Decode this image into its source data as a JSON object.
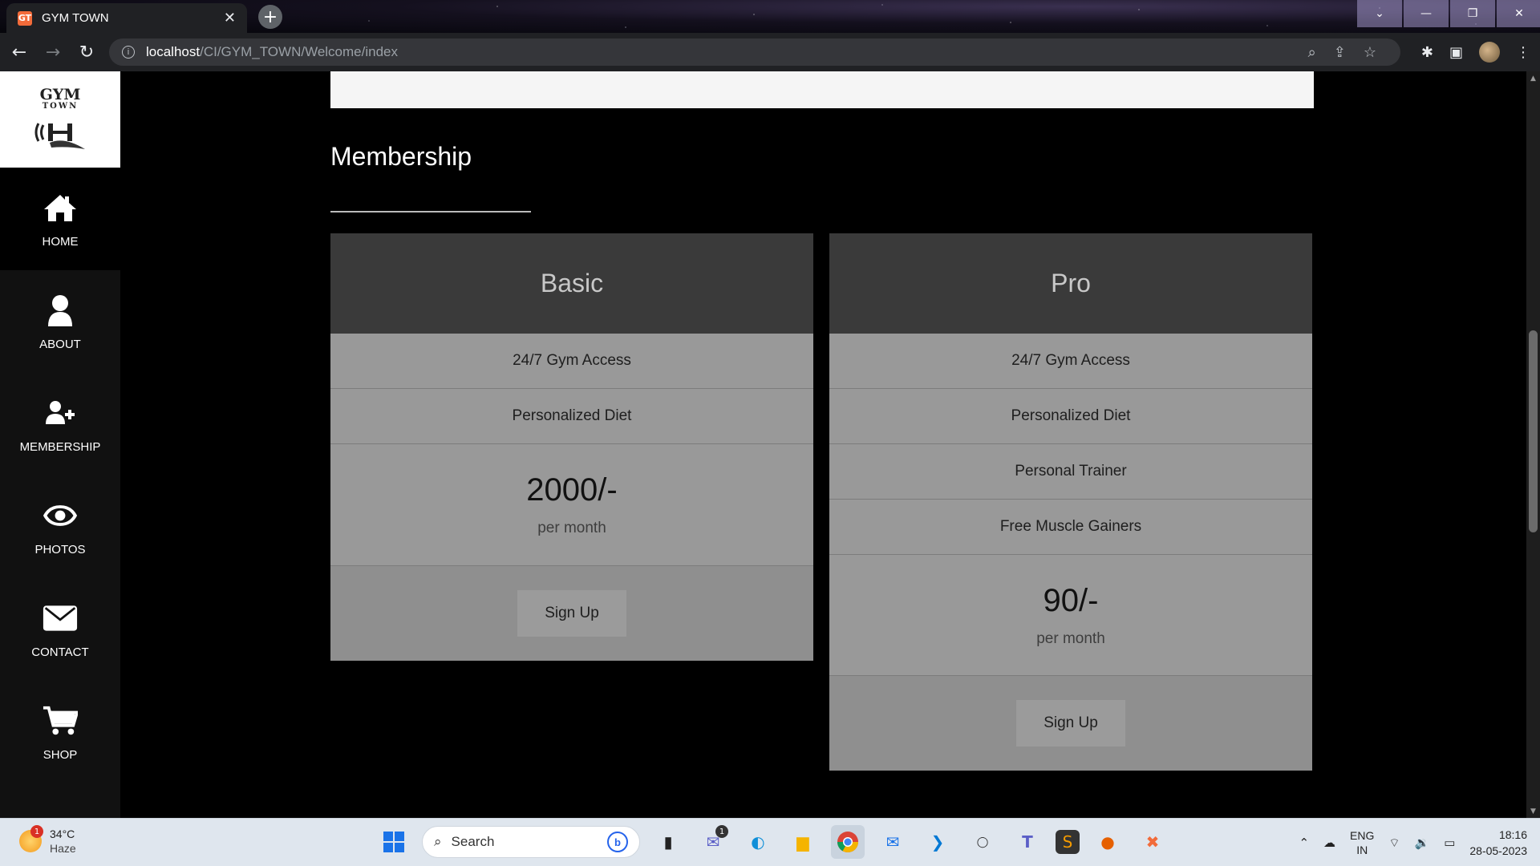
{
  "browser": {
    "tab_title": "GYM TOWN",
    "tab_favicon_label": "GT",
    "url_host": "localhost",
    "url_path": "/CI/GYM_TOWN/Welcome/index",
    "icons": [
      "back-icon",
      "forward-icon",
      "reload-icon",
      "info-icon",
      "search-icon",
      "share-icon",
      "star-icon",
      "extensions-icon",
      "sidepanel-icon",
      "profile-avatar",
      "menu-icon"
    ]
  },
  "logo": {
    "line1": "GYM",
    "line2": "TOWN"
  },
  "sidebar": {
    "items": [
      {
        "label": "HOME",
        "icon": "home-icon",
        "active": true
      },
      {
        "label": "ABOUT",
        "icon": "user-icon"
      },
      {
        "label": "MEMBERSHIP",
        "icon": "user-plus-icon"
      },
      {
        "label": "PHOTOS",
        "icon": "eye-icon"
      },
      {
        "label": "CONTACT",
        "icon": "envelope-icon"
      },
      {
        "label": "SHOP",
        "icon": "cart-icon"
      }
    ]
  },
  "membership": {
    "title": "Membership",
    "plans": [
      {
        "name": "Basic",
        "features": [
          "24/7 Gym Access",
          "Personalized Diet"
        ],
        "price": "2000/-",
        "period": "per month",
        "cta": "Sign Up"
      },
      {
        "name": "Pro",
        "features": [
          "24/7 Gym Access",
          "Personalized Diet",
          "Personal Trainer",
          "Free Muscle Gainers"
        ],
        "price": "90/-",
        "period": "per month",
        "cta": "Sign Up"
      }
    ]
  },
  "taskbar": {
    "weather_temp": "34°C",
    "weather_cond": "Haze",
    "weather_badge": "1",
    "search_label": "Search",
    "chat_badge": "1",
    "lang_line1": "ENG",
    "lang_line2": "IN",
    "time": "18:16",
    "date": "28-05-2023"
  },
  "colors": {
    "page_bg": "#000000",
    "sidebar_bg": "#111111",
    "plan_head_bg": "#3a3a3a",
    "plan_body_bg": "#999999"
  }
}
